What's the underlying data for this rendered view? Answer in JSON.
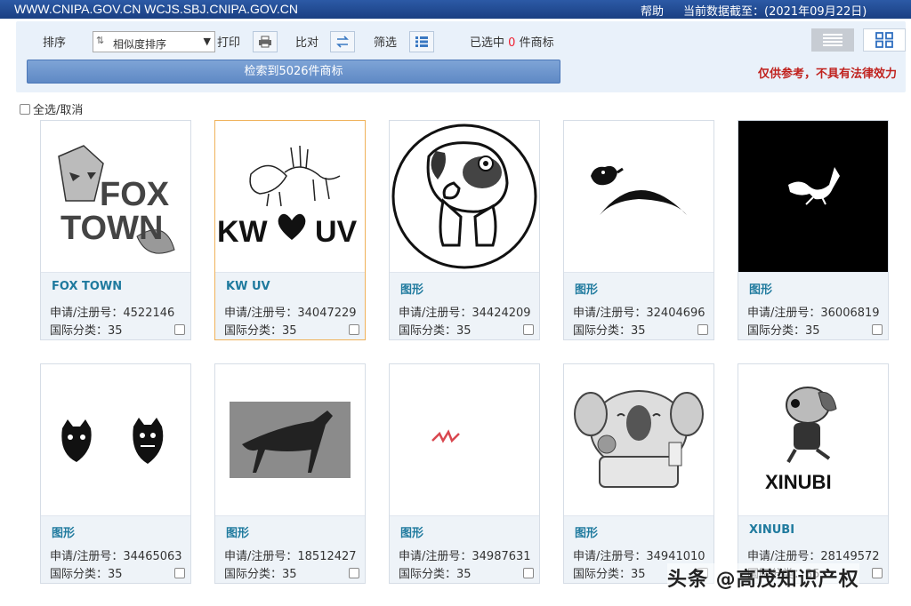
{
  "header": {
    "site": "WWW.CNIPA.GOV.CN WCJS.SBJ.CNIPA.GOV.CN",
    "help": "帮助",
    "date_label": "当前数据截至：(2021年09月22日)"
  },
  "toolbar": {
    "sort_label": "排序",
    "sort_value": "相似度排序",
    "print_label": "打印",
    "compare_label": "比对",
    "filter_label": "筛选",
    "selected_prefix": "已选中",
    "selected_count": "0",
    "selected_suffix": "件商标",
    "result_text": "检索到5026件商标",
    "disclaimer": "仅供参考，不具有法律效力"
  },
  "select_all": "全选/取消",
  "cards": [
    {
      "name": "FOX TOWN",
      "reg": "申请/注册号：4522146",
      "cls": "国际分类：35"
    },
    {
      "name": "KW UV",
      "reg": "申请/注册号：34047229",
      "cls": "国际分类：35"
    },
    {
      "name": "图形",
      "reg": "申请/注册号：34424209",
      "cls": "国际分类：35"
    },
    {
      "name": "图形",
      "reg": "申请/注册号：32404696",
      "cls": "国际分类：35"
    },
    {
      "name": "图形",
      "reg": "申请/注册号：36006819",
      "cls": "国际分类：35"
    },
    {
      "name": "图形",
      "reg": "申请/注册号：34465063",
      "cls": "国际分类：35"
    },
    {
      "name": "图形",
      "reg": "申请/注册号：18512427",
      "cls": "国际分类：35"
    },
    {
      "name": "图形",
      "reg": "申请/注册号：34987631",
      "cls": "国际分类：35"
    },
    {
      "name": "图形",
      "reg": "申请/注册号：34941010",
      "cls": "国际分类：35"
    },
    {
      "name": "XINUBI",
      "reg": "申请/注册号：28149572",
      "cls": "国际分类：35"
    }
  ],
  "logo_text": {
    "fox_line1": "FOX",
    "fox_line2": "TOWN",
    "kw": "KW",
    "uv": "UV",
    "xinubi": "XINUBI"
  },
  "watermark": "头条 @高茂知识产权"
}
